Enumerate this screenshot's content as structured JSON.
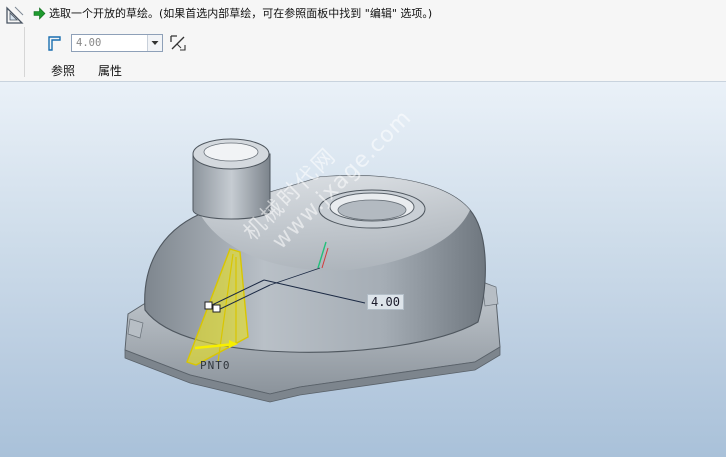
{
  "dashboard": {
    "prompt": "选取一个开放的草绘。(如果首选内部草绘，可在参照面板中找到 \"编辑\" 选项。)",
    "depth_value": "4.00",
    "tabs": [
      {
        "label": "参照"
      },
      {
        "label": "属性"
      }
    ]
  },
  "viewport": {
    "dimension_value": "4.00",
    "point_label": "PNT0",
    "watermark": {
      "line1": "机械时代网",
      "line2": "www.jxage.com"
    }
  },
  "icons": {
    "sketch_tool": "sketch-triangle-icon",
    "prompt": "green-arrow-icon",
    "thicken": "thicken-icon",
    "dropdown": "chevron-down-icon",
    "flip": "flip-direction-icon"
  },
  "colors": {
    "accent_green": "#1e9a2e",
    "sketch_yellow": "#f0e810",
    "model_gray": "#a7afb7"
  }
}
